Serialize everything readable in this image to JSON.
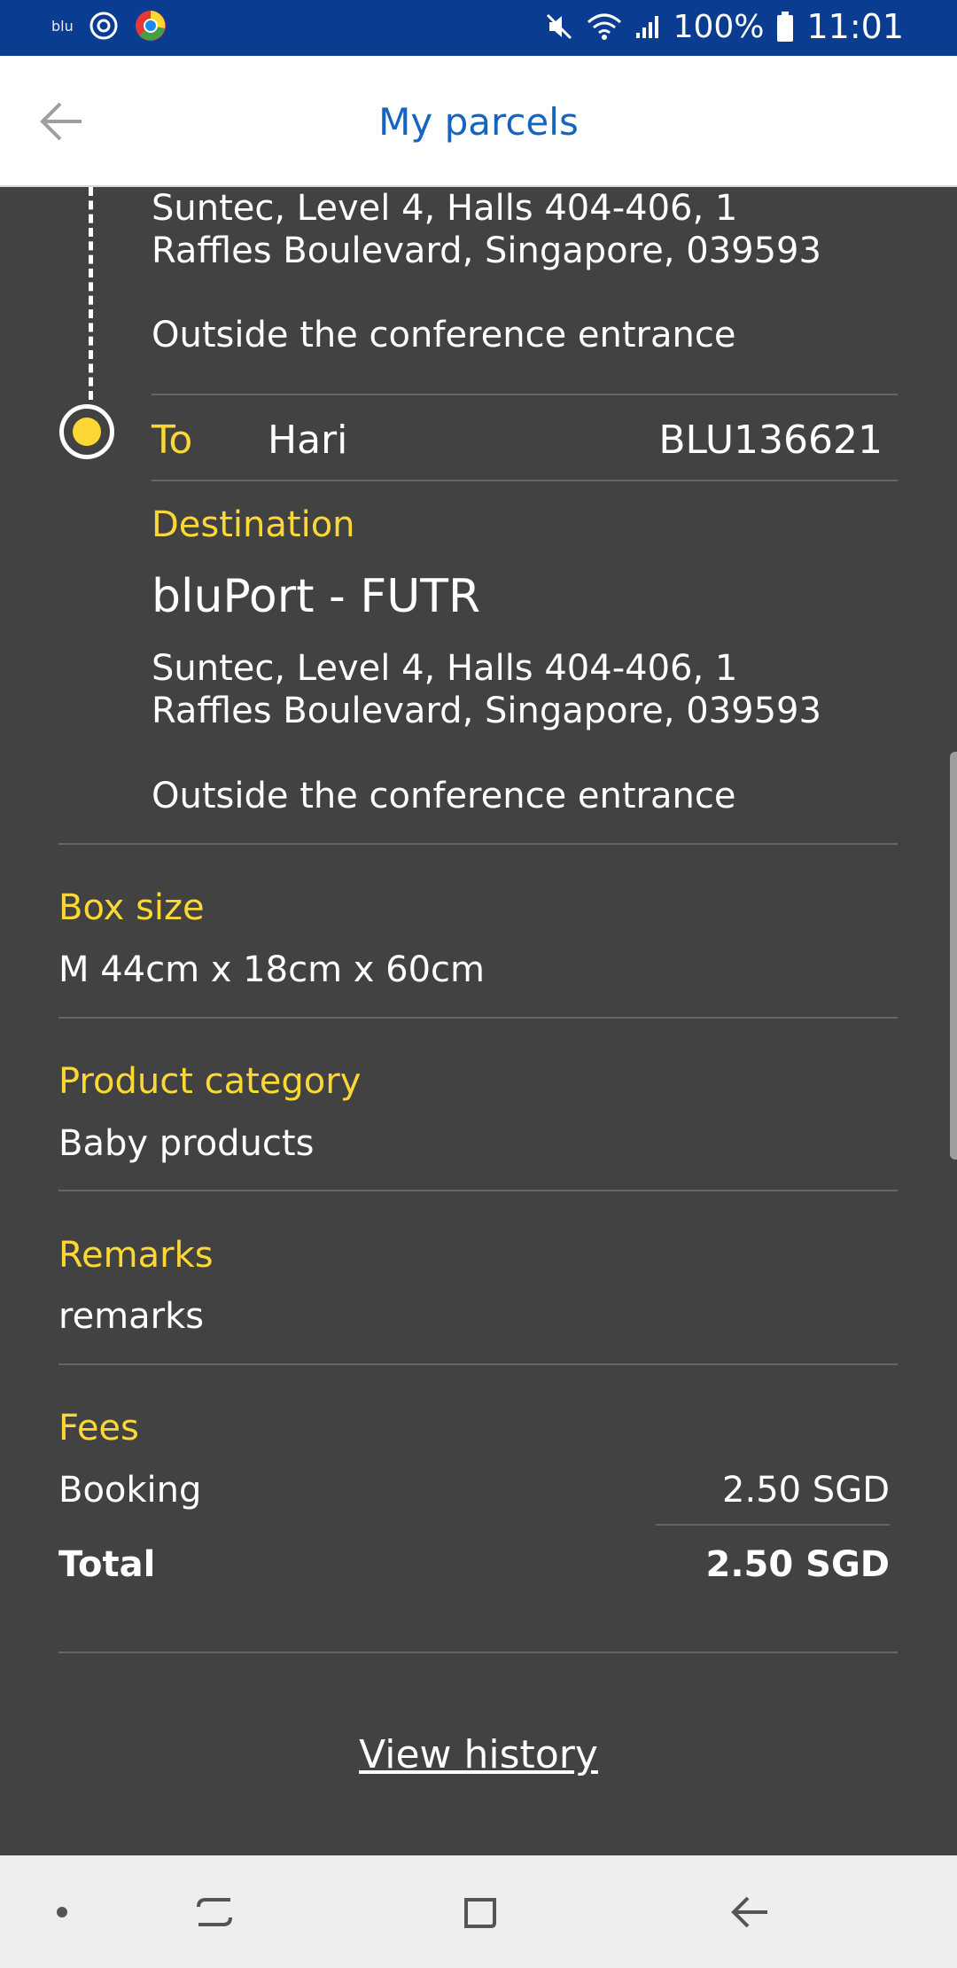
{
  "status_bar": {
    "app_label": "blu",
    "battery": "100%",
    "time": "11:01"
  },
  "header": {
    "title": "My parcels"
  },
  "origin": {
    "address": "Suntec, Level 4, Halls 404-406, 1 Raffles Boulevard, Singapore, 039593",
    "note": "Outside the conference entrance"
  },
  "recipient": {
    "label": "To",
    "name": "Hari",
    "code": "BLU136621"
  },
  "destination": {
    "label": "Destination",
    "name": "bluPort - FUTR",
    "address": "Suntec, Level 4, Halls 404-406, 1 Raffles Boulevard, Singapore, 039593",
    "note": "Outside the conference entrance"
  },
  "box_size": {
    "label": "Box size",
    "value": "M 44cm x 18cm x 60cm"
  },
  "product_category": {
    "label": "Product category",
    "value": "Baby products"
  },
  "remarks": {
    "label": "Remarks",
    "value": "remarks"
  },
  "fees": {
    "label": "Fees",
    "booking_label": "Booking",
    "booking_value": "2.50 SGD",
    "total_label": "Total",
    "total_value": "2.50 SGD"
  },
  "actions": {
    "view_history": "View history"
  },
  "colors": {
    "accent_yellow": "#fdd835",
    "status_bar_blue": "#0a3d91",
    "title_blue": "#1565c0",
    "background": "#424242"
  }
}
